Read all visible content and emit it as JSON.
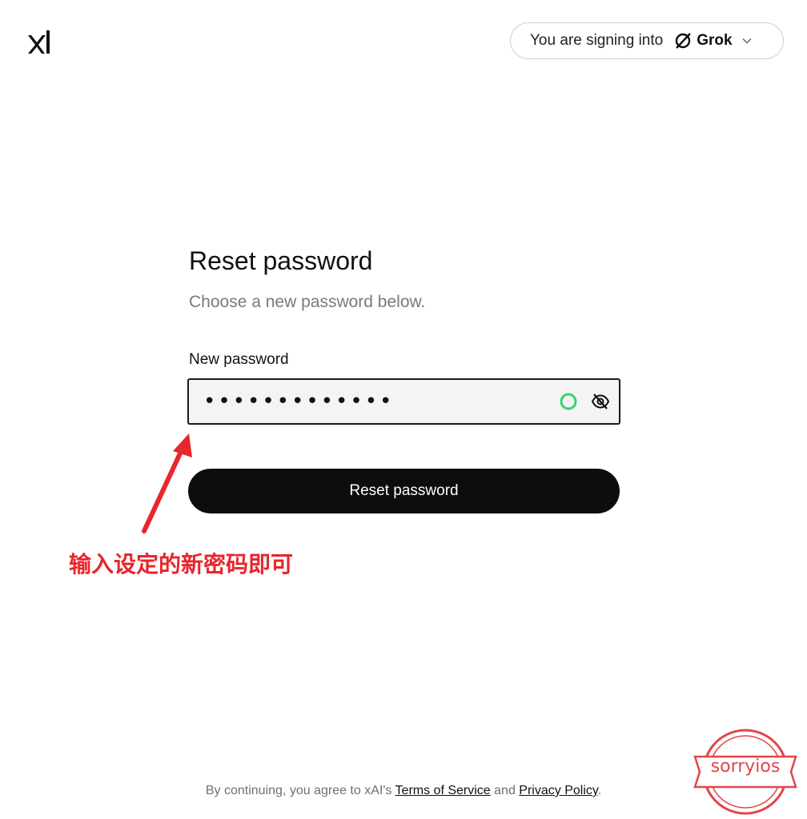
{
  "header": {
    "logo_name": "xAI",
    "signin_prefix": "You are signing into",
    "product_name": "Grok"
  },
  "form": {
    "title": "Reset password",
    "subtitle": "Choose a new password below.",
    "password_label": "New password",
    "password_value": "•••••••••••••",
    "submit_label": "Reset password"
  },
  "annotation": {
    "text": "输入设定的新密码即可",
    "color": "#e8262c"
  },
  "footer": {
    "prefix": "By continuing, you agree to xAI's",
    "terms_label": "Terms of Service",
    "conjunction": "and",
    "privacy_label": "Privacy Policy",
    "suffix": "."
  },
  "watermark": {
    "text": "sorryios"
  },
  "colors": {
    "strength_indicator": "#3ecf6e",
    "button_bg": "#0d0d0d"
  }
}
